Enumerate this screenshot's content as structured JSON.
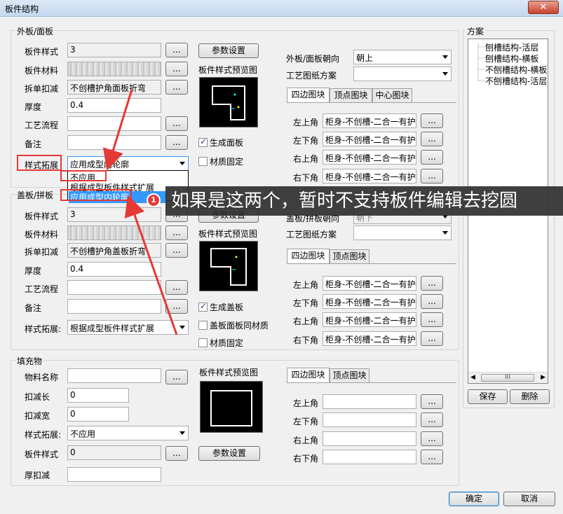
{
  "window": {
    "title": "板件结构",
    "close_label": "✕"
  },
  "outer": {
    "group_title": "外板/面板",
    "style_label": "板件样式",
    "style_value": "3",
    "material_label": "板件材料",
    "deduct_label": "拆单扣减",
    "deduct_value": "不创槽护角面板折弯",
    "thickness_label": "厚度",
    "thickness_value": "0.4",
    "process_label": "工艺流程",
    "note_label": "备注",
    "expand_label": "样式拓展",
    "expand_value": "应用成型内轮廓",
    "param_btn": "参数设置",
    "preview_label": "板件样式预览图",
    "chk_generate": "生成面板",
    "chk_material": "材质固定",
    "direction_label": "外板/面板朝向",
    "direction_value": "朝上",
    "drawing_label": "工艺图纸方案",
    "tabs": [
      "四边图块",
      "顶点图块",
      "中心图块"
    ],
    "corners": [
      {
        "label": "左上角",
        "value": "柜身-不创槽-二合一有护"
      },
      {
        "label": "左下角",
        "value": "柜身-不创槽-二合一有护"
      },
      {
        "label": "右上角",
        "value": "柜身-不创槽-二合一有护"
      },
      {
        "label": "右下角",
        "value": "柜身-不创槽-二合一有护"
      }
    ]
  },
  "dropdown": {
    "items": [
      "不应用",
      "根据成型板件样式扩展",
      "应用成型内轮廓"
    ]
  },
  "cover": {
    "group_title": "盖板/拼板",
    "style_label": "板件样式",
    "style_value": "3",
    "material_label": "板件材料",
    "deduct_label": "拆单扣减",
    "deduct_value": "不创槽护角盖板折弯",
    "thickness_label": "厚度",
    "thickness_value": "0.4",
    "process_label": "工艺流程",
    "note_label": "备注",
    "expand_label": "样式拓展:",
    "expand_value": "根据成型板件样式扩展",
    "param_btn": "参数设置",
    "preview_label": "板件样式预览图",
    "chk_generate": "生成盖板",
    "chk_same": "盖板面板同材质",
    "chk_material": "材质固定",
    "direction_label": "盖板/拼板朝向",
    "direction_value": "朝下",
    "drawing_label": "工艺图纸方案",
    "tabs": [
      "四边图块",
      "顶点图块"
    ],
    "corners": [
      {
        "label": "左上角",
        "value": "柜身-不创槽-二合一有护"
      },
      {
        "label": "左下角",
        "value": "柜身-不创槽-二合一有护"
      },
      {
        "label": "右上角",
        "value": "柜身-不创槽-二合一有护"
      },
      {
        "label": "右下角",
        "value": "柜身-不创槽-二合一有护"
      }
    ]
  },
  "filler": {
    "group_title": "填充物",
    "name_label": "物料名称",
    "len_label": "扣减长",
    "len_value": "0",
    "width_label": "扣减宽",
    "width_value": "0",
    "expand_label": "样式拓展:",
    "expand_value": "不应用",
    "style_label": "板件样式",
    "style_value": "0",
    "thick_label": "厚扣减",
    "preview_label": "板件样式预览图",
    "param_btn": "参数设置",
    "tabs": [
      "四边图块",
      "顶点图块"
    ],
    "corners": [
      {
        "label": "左上角",
        "value": ""
      },
      {
        "label": "左下角",
        "value": ""
      },
      {
        "label": "右上角",
        "value": ""
      },
      {
        "label": "右下角",
        "value": ""
      }
    ]
  },
  "scheme": {
    "group_title": "方案",
    "items": [
      "刨槽结构-活层",
      "刨槽结构-横板",
      "不刨槽结构-横板",
      "不刨槽结构-活层"
    ],
    "scroll_label": "III",
    "save_btn": "保存",
    "delete_btn": "删除"
  },
  "footer": {
    "ok_btn": "确定",
    "cancel_btn": "取消"
  },
  "browse_label": "...",
  "annotation": {
    "badge": "1",
    "text": "如果是这两个，暂时不支持板件编辑去挖圆"
  }
}
